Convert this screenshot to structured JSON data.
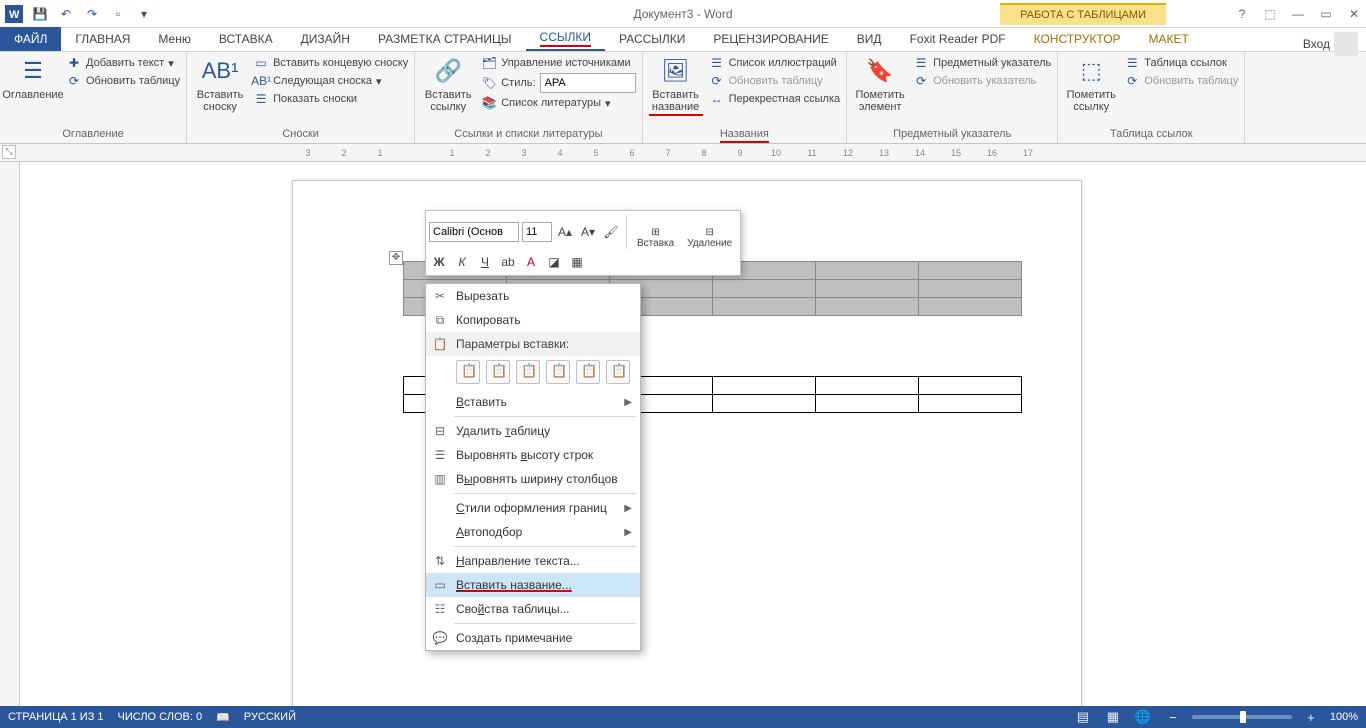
{
  "title": "Документ3 - Word",
  "table_tools_title": "РАБОТА С ТАБЛИЦАМИ",
  "tabs": {
    "file": "ФАЙЛ",
    "home": "ГЛАВНАЯ",
    "menu": "Меню",
    "insert": "ВСТАВКА",
    "design": "ДИЗАЙН",
    "layout": "РАЗМЕТКА СТРАНИЦЫ",
    "references": "ССЫЛКИ",
    "mailings": "РАССЫЛКИ",
    "review": "РЕЦЕНЗИРОВАНИЕ",
    "view": "ВИД",
    "foxit": "Foxit Reader PDF",
    "constructor": "КОНСТРУКТОР",
    "maket": "МАКЕТ",
    "login": "Вход"
  },
  "ribbon": {
    "toc": {
      "label": "Оглавление",
      "btn": "Оглавление",
      "add_text": "Добавить текст",
      "update": "Обновить таблицу"
    },
    "footnotes": {
      "label": "Сноски",
      "btn": "Вставить сноску",
      "endnote": "Вставить концевую сноску",
      "next": "Следующая сноска",
      "show": "Показать сноски"
    },
    "citations": {
      "label": "Ссылки и списки литературы",
      "btn": "Вставить ссылку",
      "manage": "Управление источниками",
      "style": "Стиль:",
      "style_value": "APA",
      "biblio": "Список литературы"
    },
    "captions": {
      "label": "Названия",
      "btn": "Вставить название",
      "list": "Список иллюстраций",
      "update": "Обновить таблицу",
      "crossref": "Перекрестная ссылка"
    },
    "index": {
      "label": "Предметный указатель",
      "btn": "Пометить элемент",
      "insert": "Предметный указатель",
      "update": "Обновить указатель"
    },
    "authorities": {
      "label": "Таблица ссылок",
      "btn": "Пометить ссылку",
      "insert": "Таблица ссылок",
      "update": "Обновить таблицу"
    }
  },
  "mini_toolbar": {
    "font": "Calibri (Основ",
    "size": "11",
    "insert": "Вставка",
    "delete": "Удаление",
    "bold": "Ж",
    "italic": "К"
  },
  "context_menu": {
    "cut": "Вырезать",
    "copy": "Копировать",
    "paste_options": "Параметры вставки:",
    "paste": "Вставить",
    "delete_table": "Удалить таблицу",
    "distribute_rows": "Выровнять высоту строк",
    "distribute_cols": "Выровнять ширину столбцов",
    "border_styles": "Стили оформления границ",
    "autofit": "Автоподбор",
    "text_direction": "Направление текста...",
    "insert_caption": "Вставить название...",
    "table_props": "Свойства таблицы...",
    "new_comment": "Создать примечание"
  },
  "status": {
    "page": "СТРАНИЦА 1 ИЗ 1",
    "words": "ЧИСЛО СЛОВ: 0",
    "lang": "РУССКИЙ",
    "zoom": "100%"
  },
  "ruler_numbers": [
    "3",
    "2",
    "1",
    "",
    "1",
    "2",
    "3",
    "4",
    "5",
    "6",
    "7",
    "8",
    "9",
    "10",
    "11",
    "12",
    "13",
    "14",
    "15",
    "16",
    "17"
  ]
}
